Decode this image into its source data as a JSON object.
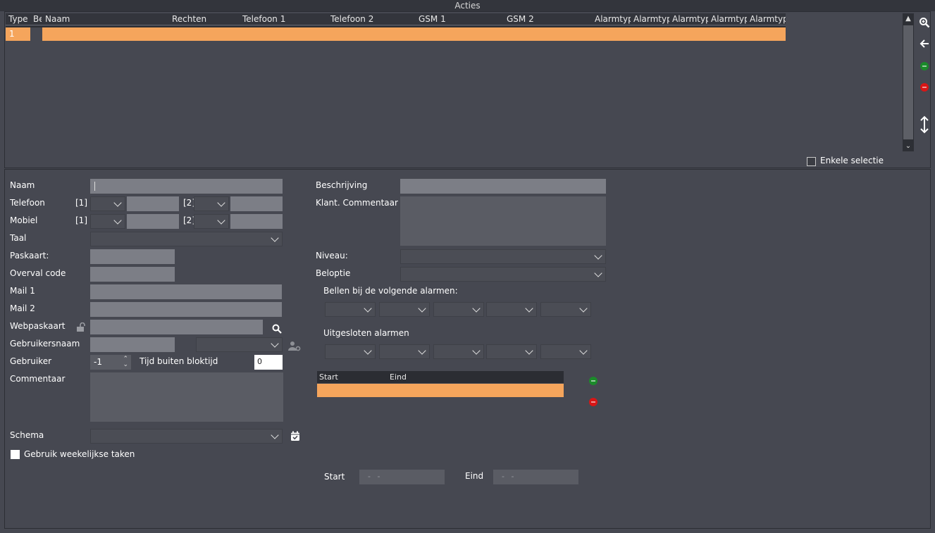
{
  "window": {
    "title": "Acties"
  },
  "grid": {
    "columns": [
      "Type",
      "Be",
      "Naam",
      "Rechten",
      "Telefoon 1",
      "Telefoon 2",
      "GSM 1",
      "GSM 2",
      "Alarmtyp",
      "Alarmtyp",
      "Alarmtyp",
      "Alarmtyp",
      "Alarmtyp"
    ],
    "rows": [
      {
        "type": "1"
      }
    ]
  },
  "toolbar": {
    "zoom_icon": "zoom-in-icon",
    "back_icon": "arrow-left-icon",
    "add_icon": "add-icon",
    "remove_icon": "remove-icon",
    "resize_icon": "vertical-resize-icon"
  },
  "single_selection": {
    "label": "Enkele selectie",
    "checked": false
  },
  "form": {
    "naam": {
      "label": "Naam",
      "value": ""
    },
    "telefoon": {
      "label": "Telefoon",
      "idx1": "[1]",
      "idx2": "[2]"
    },
    "mobiel": {
      "label": "Mobiel",
      "idx1": "[1]",
      "idx2": "[2]"
    },
    "taal": {
      "label": "Taal"
    },
    "paskaart": {
      "label": "Paskaart:"
    },
    "overval": {
      "label": "Overval code"
    },
    "mail1": {
      "label": "Mail 1"
    },
    "mail2": {
      "label": "Mail 2"
    },
    "webpaskaart": {
      "label": "Webpaskaart"
    },
    "gebruikersnaam": {
      "label": "Gebruikersnaam"
    },
    "gebruiker": {
      "label": "Gebruiker",
      "value": "-1"
    },
    "tijd_buiten": {
      "label": "Tijd buiten bloktijd",
      "value": "0"
    },
    "commentaar": {
      "label": "Commentaar"
    },
    "schema": {
      "label": "Schema"
    },
    "weekly": {
      "label": "Gebruik weekelijkse taken",
      "checked": false
    },
    "beschrijving": {
      "label": "Beschrijving"
    },
    "klant_commentaar": {
      "label": "Klant. Commentaar"
    },
    "niveau": {
      "label": "Niveau:"
    },
    "beloptie": {
      "label": "Beloptie"
    },
    "bellen": {
      "label": "Bellen bij de volgende alarmen:"
    },
    "uitgesloten": {
      "label": "Uitgesloten alarmen"
    },
    "period_grid": {
      "columns": [
        "Start",
        "Eind"
      ]
    },
    "start": {
      "label": "Start",
      "value": "- -"
    },
    "eind": {
      "label": "Eind",
      "value": "- -"
    }
  },
  "colors": {
    "selection": "#f5a55c",
    "background": "#464851",
    "field": "#7c7e86",
    "header": "#33353c"
  }
}
